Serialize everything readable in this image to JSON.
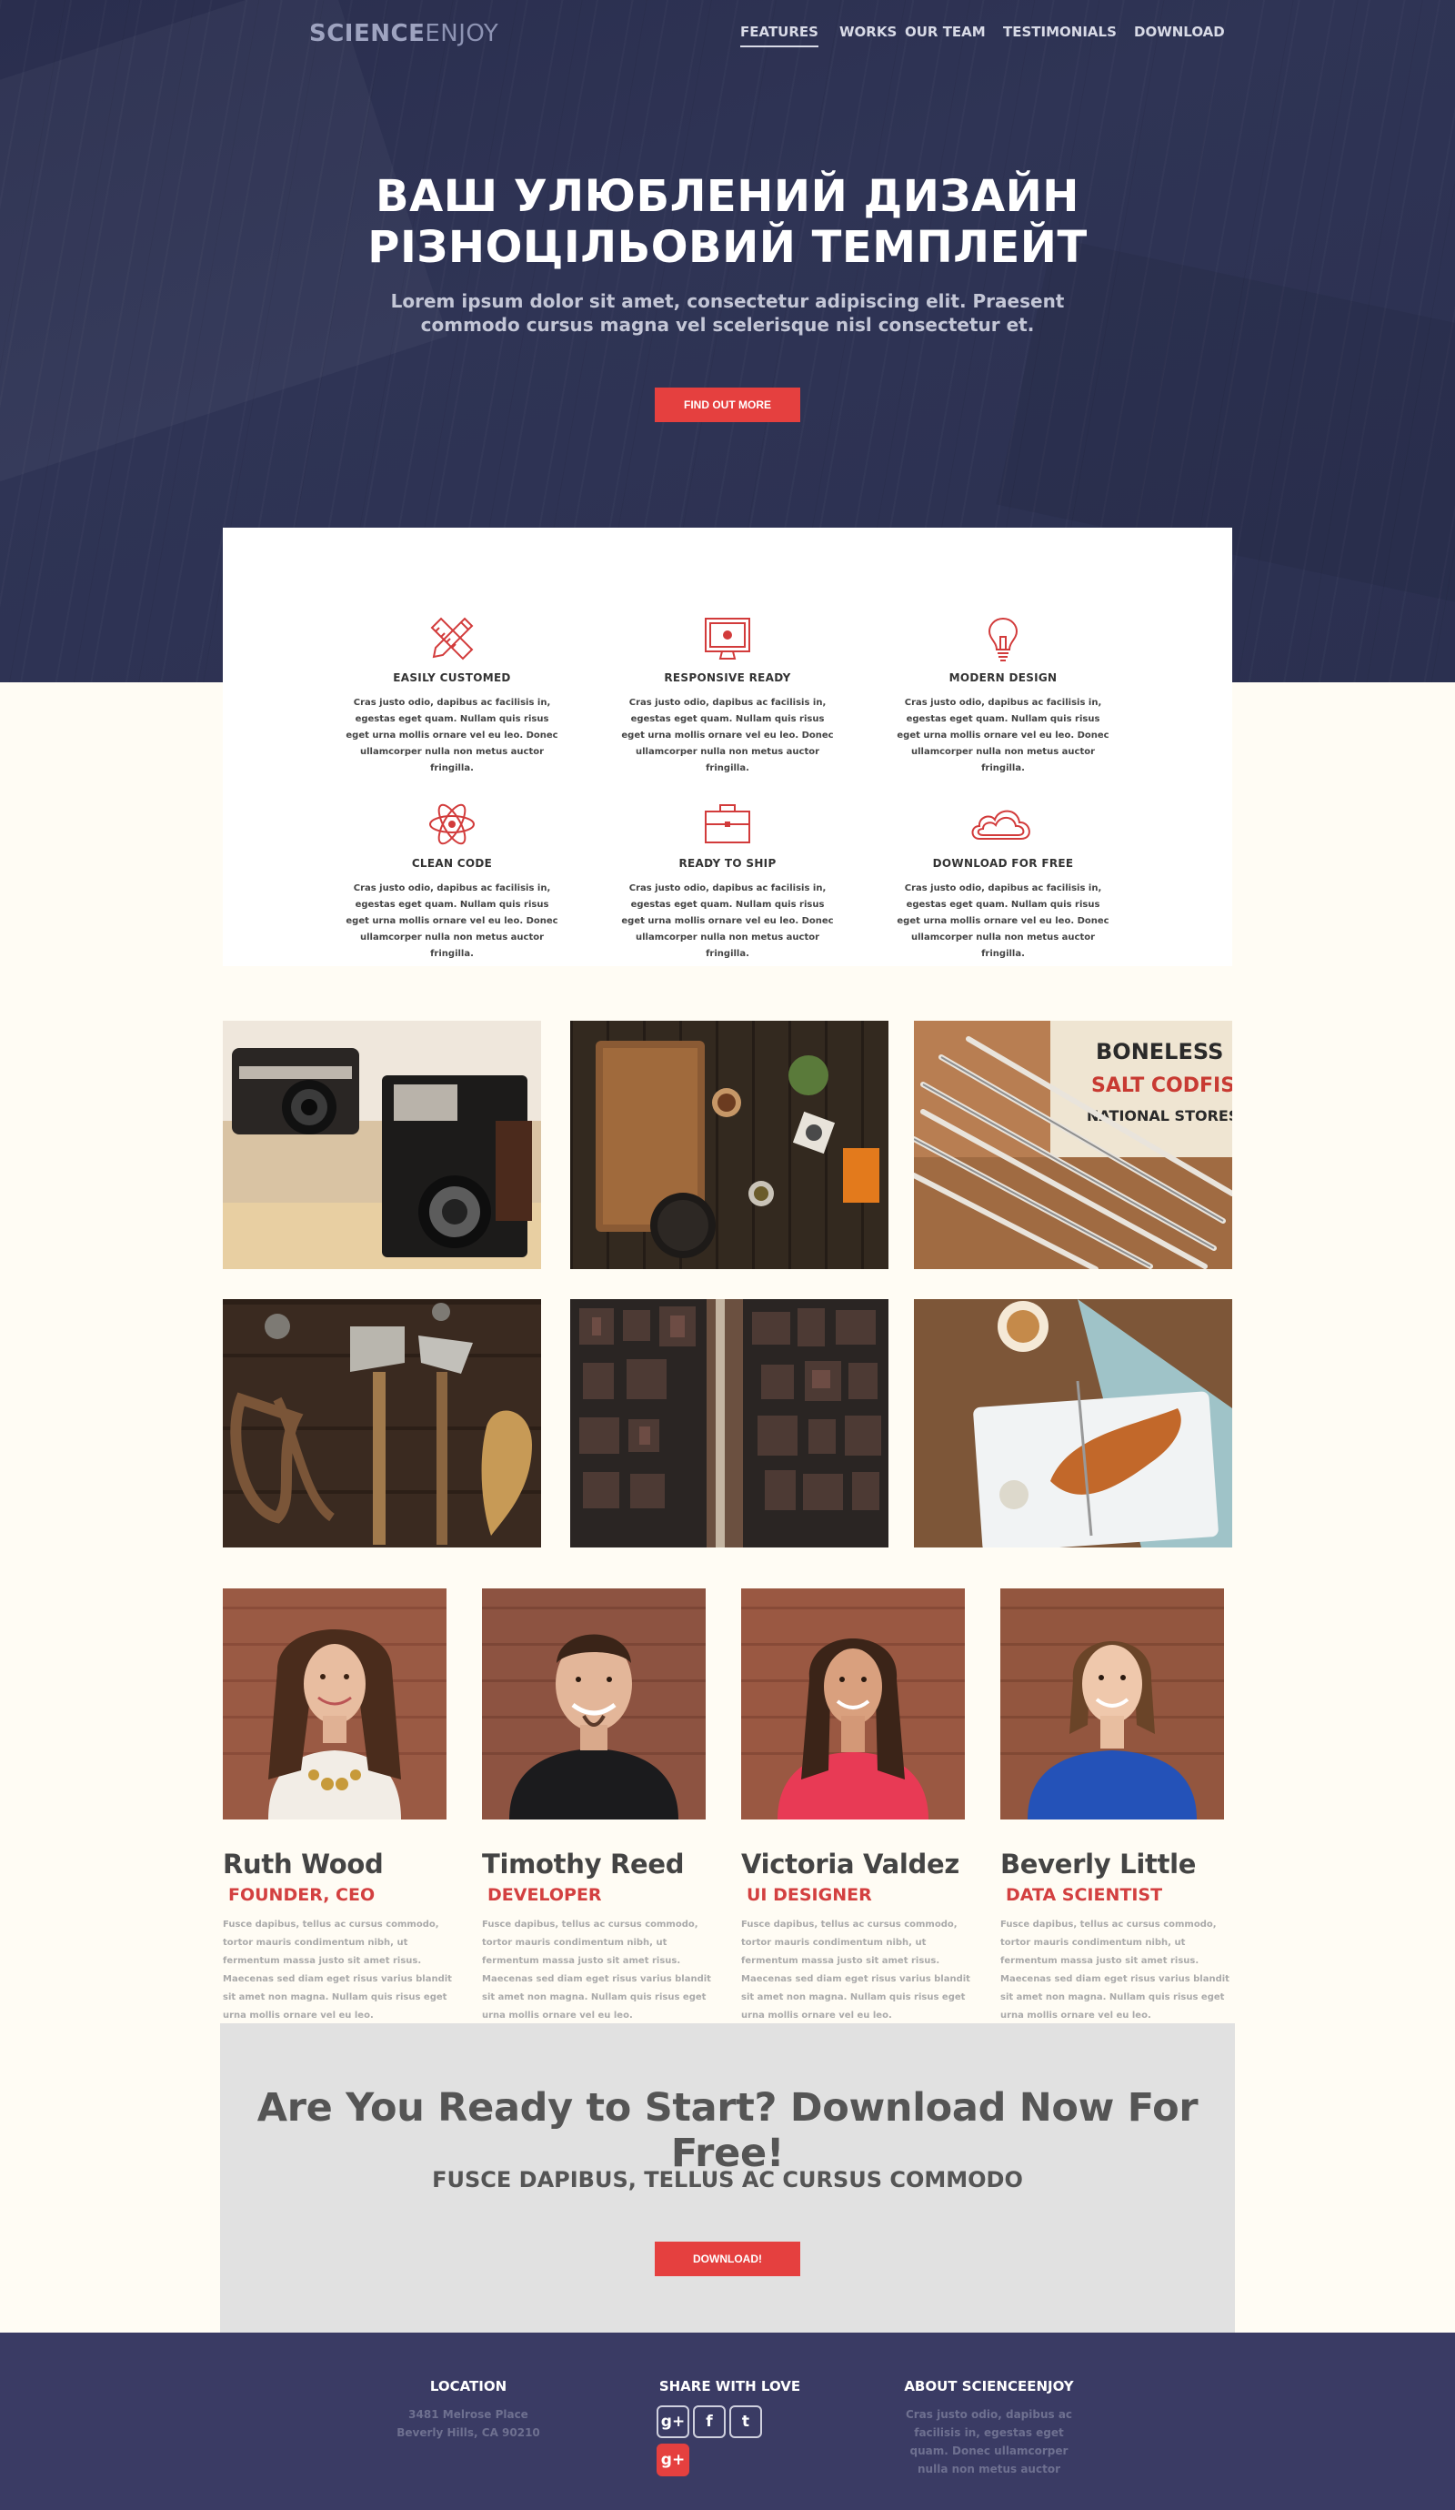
{
  "brand": {
    "logo_bold": "SCIENCE",
    "logo_light": "ENJOY"
  },
  "nav": {
    "features": "FEATURES",
    "works": "WORKS",
    "team": "OUR TEAM",
    "testimonials": "TESTIMONIALS",
    "download": "DOWNLOAD"
  },
  "hero": {
    "title_line1": "ВАШ УЛЮБЛЕНИЙ ДИЗАЙН",
    "title_line2": "РІЗНОЦІЛЬОВИЙ ТЕМПЛЕЙТ",
    "sub_line1": "Lorem ipsum dolor sit amet, consectetur adipiscing elit. Praesent",
    "sub_line2": "commodo cursus magna vel scelerisque nisl consectetur et.",
    "button": "FIND OUT MORE"
  },
  "features": [
    {
      "icon": "pencil-ruler-icon",
      "title": "EASILY CUSTOMED",
      "text": "Cras justo odio, dapibus ac facilisis in, egestas eget quam. Nullam quis risus eget urna mollis ornare vel eu leo. Donec ullamcorper nulla non metus auctor fringilla."
    },
    {
      "icon": "monitor-icon",
      "title": "RESPONSIVE READY",
      "text": "Cras justo odio, dapibus ac facilisis in, egestas eget quam. Nullam quis risus eget urna mollis ornare vel eu leo. Donec ullamcorper nulla non metus auctor fringilla."
    },
    {
      "icon": "lightbulb-icon",
      "title": "MODERN DESIGN",
      "text": "Cras justo odio, dapibus ac facilisis in, egestas eget quam. Nullam quis risus eget urna mollis ornare vel eu leo. Donec ullamcorper nulla non metus auctor fringilla."
    },
    {
      "icon": "atom-icon",
      "title": "CLEAN CODE",
      "text": "Cras justo odio, dapibus ac facilisis in, egestas eget quam. Nullam quis risus eget urna mollis ornare vel eu leo. Donec ullamcorper nulla non metus auctor fringilla."
    },
    {
      "icon": "briefcase-icon",
      "title": "READY TO SHIP",
      "text": "Cras justo odio, dapibus ac facilisis in, egestas eget quam. Nullam quis risus eget urna mollis ornare vel eu leo. Donec ullamcorper nulla non metus auctor fringilla."
    },
    {
      "icon": "cloud-icon",
      "title": "DOWNLOAD FOR FREE",
      "text": "Cras justo odio, dapibus ac facilisis in, egestas eget quam. Nullam quis risus eget urna mollis ornare vel eu leo. Donec ullamcorper nulla non metus auctor fringilla."
    }
  ],
  "gallery_sign": {
    "line1": "BONELESS",
    "line2": "SALT CODFISH",
    "line3": "NATIONAL STORES"
  },
  "team": [
    {
      "name": "Ruth Wood",
      "role": "FOUNDER, CEO",
      "bio": "Fusce dapibus, tellus ac cursus commodo, tortor mauris condimentum nibh, ut fermentum massa justo sit amet risus. Maecenas sed diam eget risus varius blandit sit amet non magna. Nullam quis risus eget urna mollis ornare vel eu leo."
    },
    {
      "name": "Timothy Reed",
      "role": "DEVELOPER",
      "bio": "Fusce dapibus, tellus ac cursus commodo, tortor mauris condimentum nibh, ut fermentum massa justo sit amet risus. Maecenas sed diam eget risus varius blandit sit amet non magna. Nullam quis risus eget urna mollis ornare vel eu leo."
    },
    {
      "name": "Victoria Valdez",
      "role": "UI DESIGNER",
      "bio": "Fusce dapibus, tellus ac cursus commodo, tortor mauris condimentum nibh, ut fermentum massa justo sit amet risus. Maecenas sed diam eget risus varius blandit sit amet non magna. Nullam quis risus eget urna mollis ornare vel eu leo."
    },
    {
      "name": "Beverly Little",
      "role": "DATA SCIENTIST",
      "bio": "Fusce dapibus, tellus ac cursus commodo, tortor mauris condimentum nibh, ut fermentum massa justo sit amet risus. Maecenas sed diam eget risus varius blandit sit amet non magna. Nullam quis risus eget urna mollis ornare vel eu leo."
    }
  ],
  "cta": {
    "title": "Are You Ready to Start? Download Now For Free!",
    "subtitle": "FUSCE DAPIBUS, TELLUS AC CURSUS COMMODO",
    "button": "DOWNLOAD!"
  },
  "footer": {
    "location_title": "LOCATION",
    "address_line1": "3481 Melrose Place",
    "address_line2": "Beverly Hills, CA 90210",
    "share_title": "SHARE WITH LOVE",
    "about_title": "ABOUT SCIENCEENJOY",
    "about_line1": "Cras justo odio, dapibus ac",
    "about_line2": "facilisis in, egestas eget",
    "about_line3": "quam. Donec ullamcorper",
    "about_line4": "nulla non metus auctor",
    "social": {
      "gplus": "g+",
      "facebook": "f",
      "twitter": "t"
    }
  },
  "colors": {
    "accent": "#e5403f",
    "hero_bg": "#2f3455",
    "footer_bg": "#3a3b64",
    "page_bg": "#fffcf4"
  }
}
